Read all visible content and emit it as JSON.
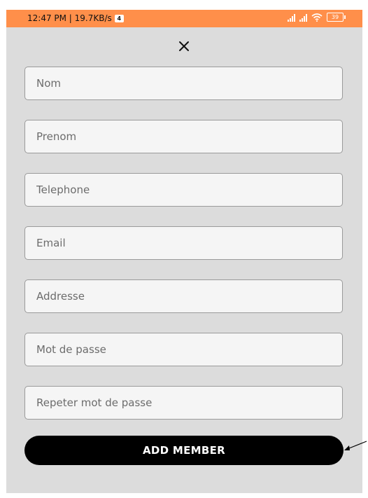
{
  "status_bar": {
    "left_text": "12:47 PM | 19.7KB/s",
    "notification_badge": "4",
    "battery_level": "39",
    "icons": [
      "signal-icon",
      "signal-icon",
      "wifi-icon",
      "battery-icon"
    ]
  },
  "colors": {
    "status_bar": "#ff8f4a",
    "background": "#dcdcdc",
    "field_background": "#f5f5f5",
    "field_border": "#9a9a9a",
    "button_background": "#000000",
    "button_text": "#ffffff"
  },
  "header": {
    "close_icon": "close-icon"
  },
  "form": {
    "fields": [
      {
        "name": "nom",
        "placeholder": "Nom",
        "value": ""
      },
      {
        "name": "prenom",
        "placeholder": "Prenom",
        "value": ""
      },
      {
        "name": "telephone",
        "placeholder": "Telephone",
        "value": ""
      },
      {
        "name": "email",
        "placeholder": "Email",
        "value": ""
      },
      {
        "name": "addresse",
        "placeholder": "Addresse",
        "value": ""
      },
      {
        "name": "mot-de-passe",
        "placeholder": "Mot de passe",
        "value": ""
      },
      {
        "name": "repeter-mot-de-passe",
        "placeholder": "Repeter mot de passe",
        "value": ""
      }
    ],
    "submit_label": "ADD MEMBER"
  },
  "annotation": {
    "arrow_icon": "arrow-annotation-icon"
  }
}
